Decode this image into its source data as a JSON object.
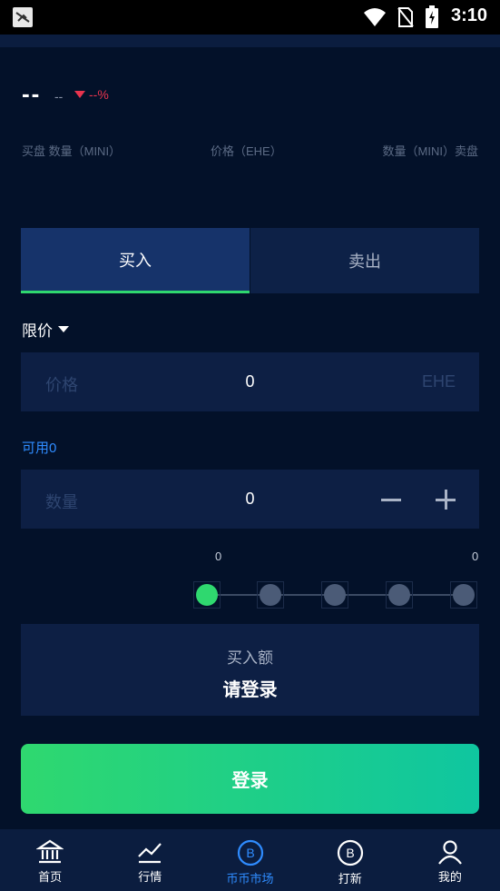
{
  "status": {
    "time": "3:10"
  },
  "ticker": {
    "price": "--",
    "sub": "--",
    "change": "--%"
  },
  "orderbook": {
    "col_left": "买盘 数量（MINI）",
    "col_mid": "价格（EHE）",
    "col_right": "数量（MINI）卖盘"
  },
  "tabs": [
    {
      "label": "买入"
    },
    {
      "label": "卖出"
    }
  ],
  "order_type": "限价",
  "price_field": {
    "label": "价格",
    "value": "0",
    "unit": "EHE"
  },
  "available": "可用0",
  "qty_field": {
    "label": "数量",
    "value": "0"
  },
  "slider": {
    "left_value": "0",
    "right_value": "0",
    "level": 0
  },
  "amount": {
    "title": "买入额",
    "value": "请登录"
  },
  "login_button": "登录",
  "nav": [
    {
      "label": "首页",
      "icon": "bank-icon"
    },
    {
      "label": "行情",
      "icon": "chart-line-icon"
    },
    {
      "label": "币币市场",
      "icon": "b-circle-icon",
      "active": true
    },
    {
      "label": "打新",
      "icon": "b-circle-icon"
    },
    {
      "label": "我的",
      "icon": "user-icon"
    }
  ],
  "colors": {
    "accent_green": "#2fd86f",
    "accent_blue": "#2f8cff",
    "down_red": "#e8344e",
    "background": "#031129"
  }
}
